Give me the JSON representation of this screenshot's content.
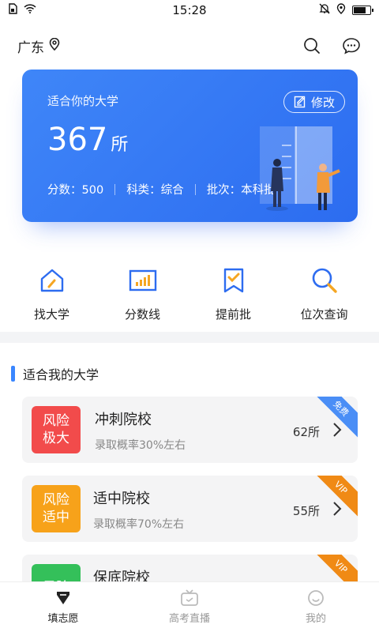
{
  "status": {
    "time": "15:28"
  },
  "header": {
    "location": "广东"
  },
  "hero": {
    "subtitle": "适合你的大学",
    "count": "367",
    "unit": "所",
    "edit_label": "修改",
    "score": "分数：500",
    "subject": "科类：综合",
    "batch": "批次：本科批"
  },
  "quick": [
    {
      "label": "找大学",
      "icon": "home-pencil-icon"
    },
    {
      "label": "分数线",
      "icon": "bar-chart-icon"
    },
    {
      "label": "提前批",
      "icon": "bookmark-check-icon"
    },
    {
      "label": "位次查询",
      "icon": "search-icon"
    }
  ],
  "section": {
    "title": "适合我的大学"
  },
  "cards": [
    {
      "badge": "风险极大",
      "title": "冲刺院校",
      "desc": "录取概率30%左右",
      "count": "62所",
      "ribbon": "免费",
      "badge_color": "#f24b4b",
      "ribbon_color": "#4a8ef6"
    },
    {
      "badge": "风险适中",
      "title": "适中院校",
      "desc": "录取概率70%左右",
      "count": "55所",
      "ribbon": "VIP",
      "badge_color": "#f7a21a",
      "ribbon_color": "#f08a15"
    },
    {
      "badge": "风险",
      "title": "保底院校",
      "desc": "",
      "count": "",
      "ribbon": "VIP",
      "badge_color": "#34c05a",
      "ribbon_color": "#f08a15"
    }
  ],
  "nav": [
    {
      "label": "填志愿",
      "icon": "volunteer-icon",
      "active": true
    },
    {
      "label": "高考直播",
      "icon": "tv-icon",
      "active": false
    },
    {
      "label": "我的",
      "icon": "smile-icon",
      "active": false
    }
  ]
}
